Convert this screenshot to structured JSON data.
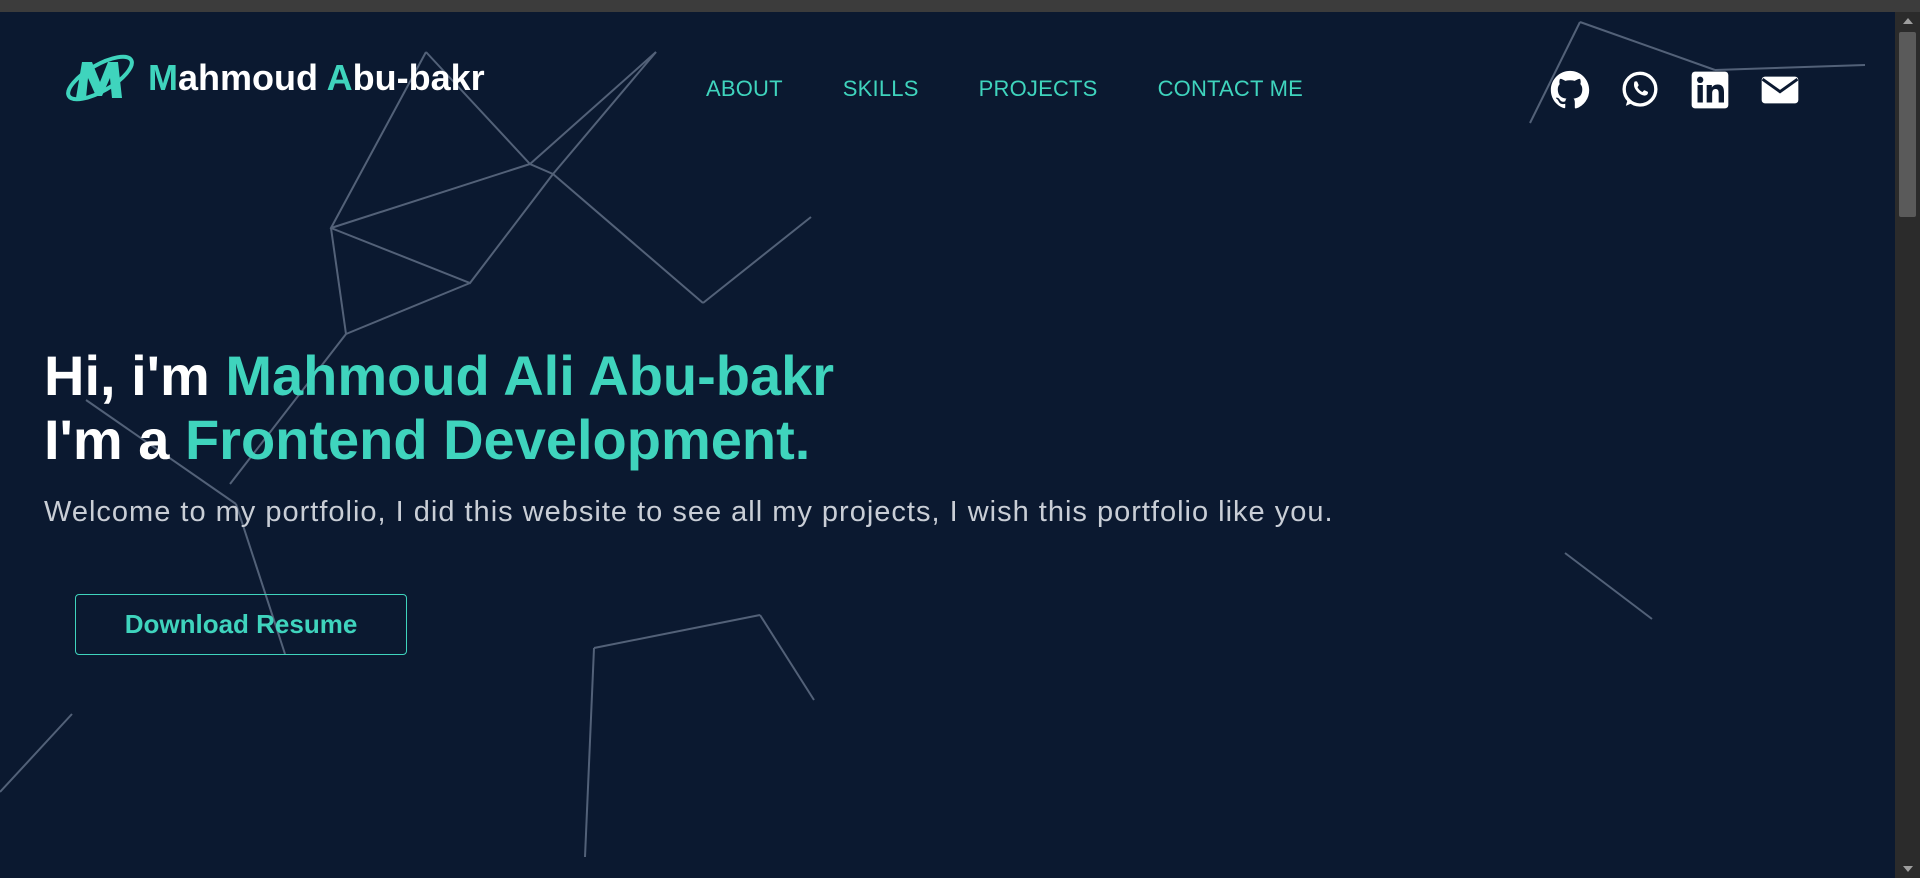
{
  "header": {
    "logo": {
      "first_initial": "M",
      "first_rest": "ahmoud ",
      "last_initial": "A",
      "last_rest": "bu-bakr"
    },
    "nav": [
      {
        "label": "ABOUT"
      },
      {
        "label": "SKILLS"
      },
      {
        "label": "PROJECTS"
      },
      {
        "label": "CONTACT ME"
      }
    ],
    "socials": [
      {
        "icon": "github-icon"
      },
      {
        "icon": "whatsapp-icon"
      },
      {
        "icon": "linkedin-icon"
      },
      {
        "icon": "envelope-icon"
      }
    ]
  },
  "hero": {
    "line1_prefix": "Hi, i'm ",
    "line1_name": "Mahmoud Ali Abu-bakr",
    "line2_prefix": "I'm a ",
    "line2_role": "Frontend Development.",
    "subtitle": "Welcome to my portfolio, I did this website to see all my projects, I wish this portfolio like you.",
    "cta_label": "Download Resume"
  },
  "colors": {
    "background": "#0b1930",
    "accent": "#3fd4bd",
    "text": "#ffffff",
    "muted_text": "#c9ced6",
    "lines": "#6b7a90"
  }
}
